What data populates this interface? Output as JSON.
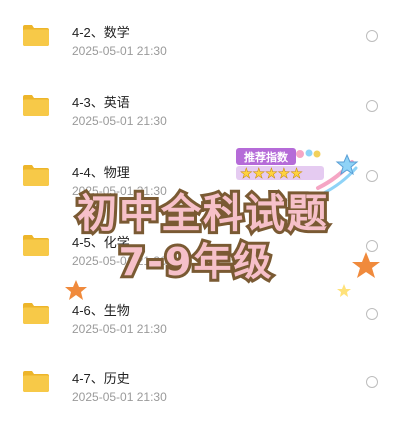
{
  "files": [
    {
      "name": "4-2、数学",
      "time": "2025-05-01  21:30"
    },
    {
      "name": "4-3、英语",
      "time": "2025-05-01  21:30"
    },
    {
      "name": "4-4、物理",
      "time": "2025-05-01  21:30"
    },
    {
      "name": "4-5、化学",
      "time": "2025-05-01  21:30"
    },
    {
      "name": "4-6、生物",
      "time": "2025-05-01  21:30"
    },
    {
      "name": "4-7、历史",
      "time": "2025-05-01  21:30"
    }
  ],
  "overlay": {
    "line1": "初中全科试题",
    "line2": "7-9年级",
    "badge": "推荐指数",
    "stars": "★★★★★",
    "rating": 5
  },
  "colors": {
    "folder": "#F7C948",
    "folder_dark": "#EDB52A",
    "title_fill": "#F6C0C9",
    "title_stroke": "#7A5A33",
    "badge_bg": "#B56BD8",
    "star": "#FFD23F",
    "accent_star": "#F08A3C"
  }
}
